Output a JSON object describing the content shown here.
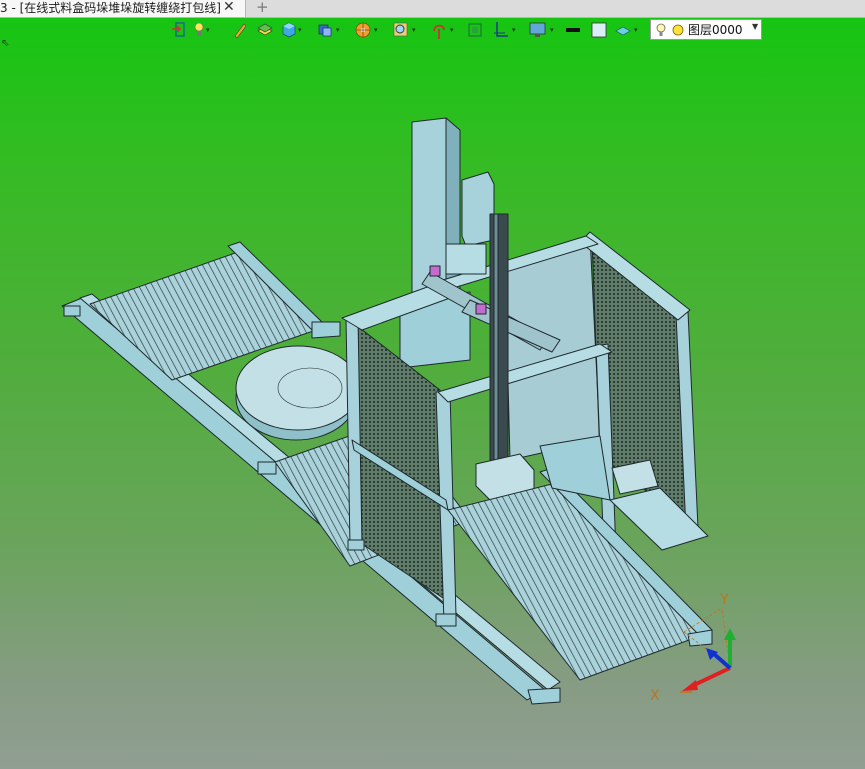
{
  "window": {
    "tab_title": "3 - [在线式料盒码垛堆垛旋转缠绕打包线]",
    "close_glyph": "✕",
    "new_tab_glyph": "+"
  },
  "toolbar": {
    "items": [
      "exit-icon",
      "light-icon",
      "pen-icon",
      "layers-stack-icon",
      "solid-cube-icon",
      "view-cube-icon",
      "render-wheel-icon",
      "zoom-icon",
      "pivot-icon",
      "fit-view-icon",
      "section-plane-icon",
      "display-monitor-icon",
      "line-color-swatch-icon",
      "fill-color-swatch-icon",
      "plane-icon"
    ],
    "line_color": "#111111",
    "fill_color": "#d9eef5",
    "dropdown_glyph": "▾"
  },
  "layer": {
    "name": "图层0000",
    "icons": [
      "bulb-icon",
      "layer-status-icon"
    ],
    "status_color": "#ffe13a",
    "arrow_glyph": "▼"
  },
  "axis": {
    "x_label": "X",
    "y_label": "Y",
    "x_color": "#e02020",
    "y_color": "#20b030",
    "z_color": "#1030d0"
  },
  "viewport": {
    "background_top": "#16c512",
    "background_bottom": "#909e93",
    "model_color": "#9fcfd8",
    "edge_color": "#1e2a2e"
  },
  "cursor_glyph": "⇖"
}
